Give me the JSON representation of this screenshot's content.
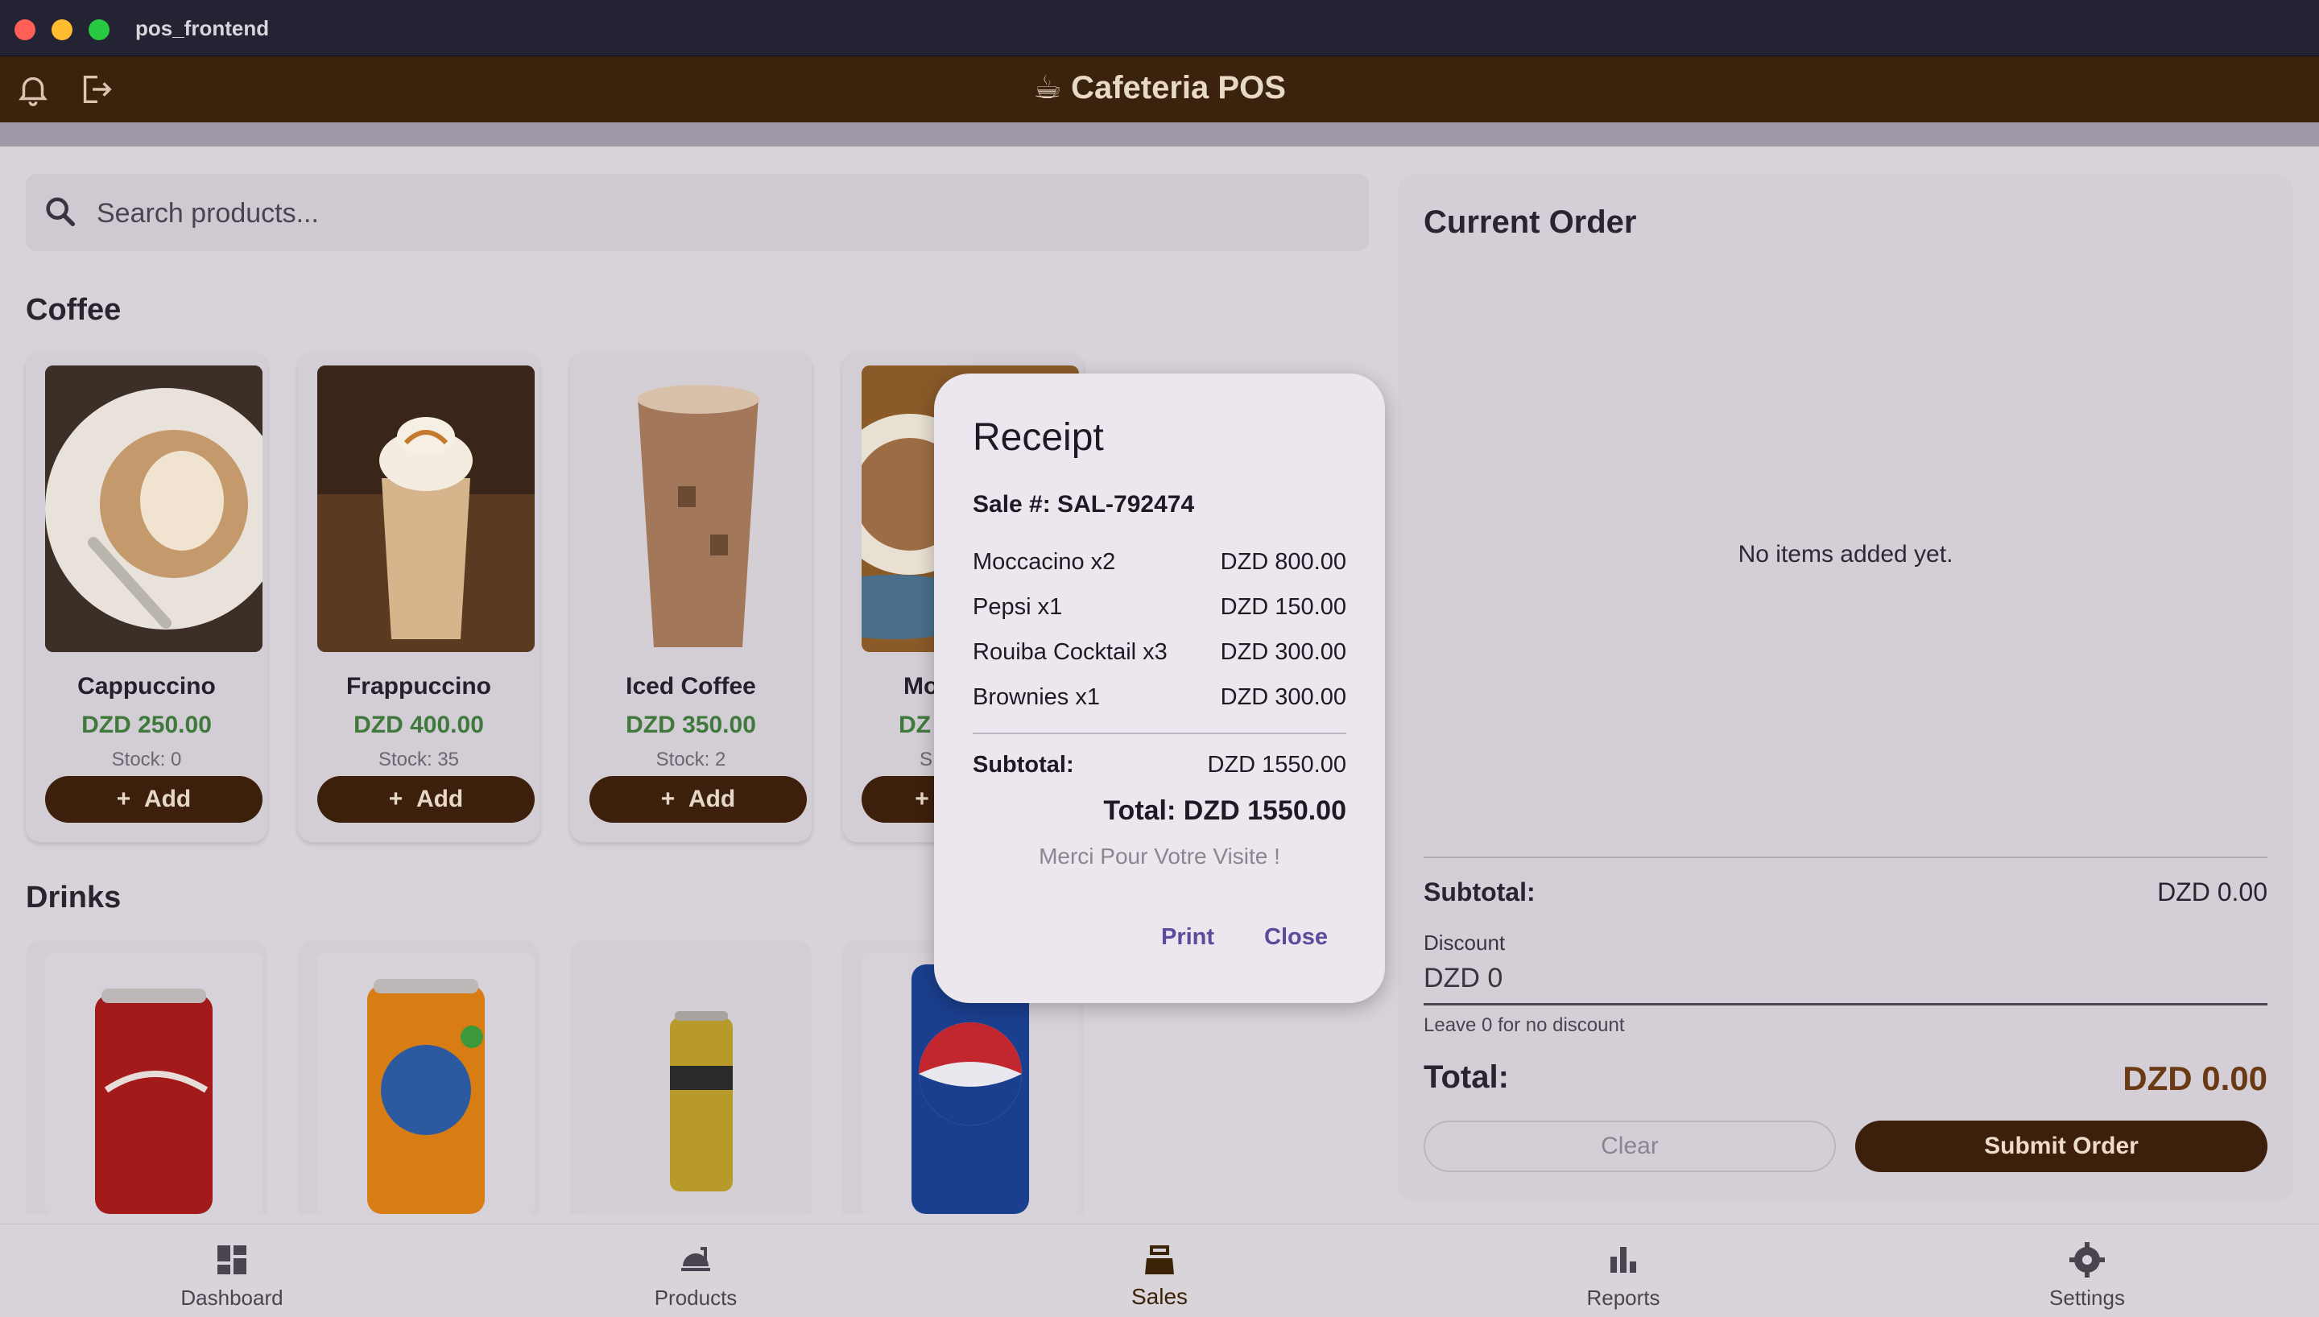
{
  "window": {
    "title": "pos_frontend"
  },
  "appbar": {
    "title": "☕ Cafeteria POS"
  },
  "search": {
    "placeholder": "Search products..."
  },
  "sections": {
    "coffee": {
      "title": "Coffee",
      "products": [
        {
          "name": "Cappuccino",
          "price": "DZD 250.00",
          "stock": "Stock: 0",
          "add": "Add"
        },
        {
          "name": "Frappuccino",
          "price": "DZD 400.00",
          "stock": "Stock: 35",
          "add": "Add"
        },
        {
          "name": "Iced Coffee",
          "price": "DZD 350.00",
          "stock": "Stock: 2",
          "add": "Add"
        },
        {
          "name": "Mo",
          "price": "DZ",
          "stock": "S",
          "add": ""
        }
      ]
    },
    "drinks": {
      "title": "Drinks",
      "products": [
        {
          "image": "coca-cola"
        },
        {
          "image": "fanta"
        },
        {
          "image": "hamoud"
        },
        {
          "image": "pepsi"
        }
      ]
    }
  },
  "order": {
    "title": "Current Order",
    "empty": "No items added yet.",
    "subtotal_label": "Subtotal:",
    "subtotal_value": "DZD 0.00",
    "discount_label": "Discount",
    "discount_value": "DZD 0",
    "discount_help": "Leave 0 for no discount",
    "total_label": "Total:",
    "total_value": "DZD 0.00",
    "clear": "Clear",
    "submit": "Submit Order"
  },
  "nav": [
    {
      "label": "Dashboard",
      "icon": "dashboard-icon"
    },
    {
      "label": "Products",
      "icon": "products-icon"
    },
    {
      "label": "Sales",
      "icon": "sales-icon",
      "active": true
    },
    {
      "label": "Reports",
      "icon": "reports-icon"
    },
    {
      "label": "Settings",
      "icon": "settings-icon"
    }
  ],
  "receipt": {
    "title": "Receipt",
    "sale": "Sale #: SAL-792474",
    "items": [
      {
        "label": "Moccacino x2",
        "amount": "DZD 800.00"
      },
      {
        "label": "Pepsi x1",
        "amount": "DZD 150.00"
      },
      {
        "label": "Rouiba Cocktail x3",
        "amount": "DZD 300.00"
      },
      {
        "label": "Brownies x1",
        "amount": "DZD 300.00"
      }
    ],
    "subtotal_label": "Subtotal:",
    "subtotal_value": "DZD 1550.00",
    "total": "Total: DZD 1550.00",
    "thanks": "Merci Pour Votre Visite !",
    "print": "Print",
    "close": "Close"
  },
  "colors": {
    "appbar": "#3a220d",
    "accent_button": "#3d200b",
    "price_green": "#3f7a3c",
    "dialog_button": "#5d4a9a"
  }
}
